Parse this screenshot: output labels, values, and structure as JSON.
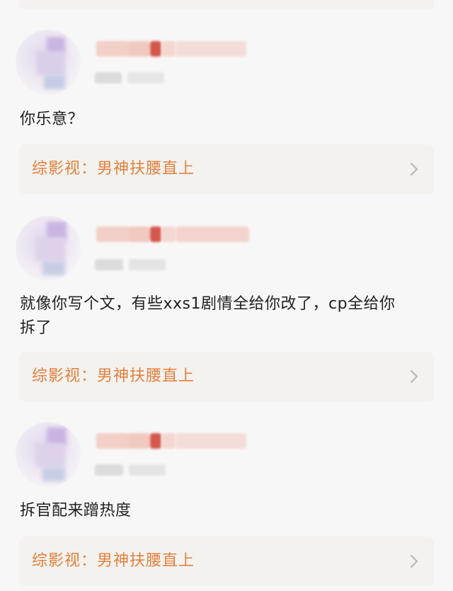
{
  "posts": [
    {
      "content": "你乐意？",
      "link_label": "综影视：男神扶腰直上",
      "link_icon": "chevron-right-icon"
    },
    {
      "content_line1": "就像你写个文，有些xxs1剧情全给你改了，cp全给你",
      "content_line2": "拆了",
      "link_label": "综影视：男神扶腰直上",
      "link_icon": "chevron-right-icon"
    },
    {
      "content": "拆官配来蹭热度",
      "link_label": "综影视：男神扶腰直上",
      "link_icon": "chevron-right-icon"
    }
  ],
  "colors": {
    "background": "#f8f7f7",
    "card": "#f4f2ee",
    "link_text": "#e2803f",
    "body_text": "#222222",
    "chevron": "#b8b8b8"
  }
}
